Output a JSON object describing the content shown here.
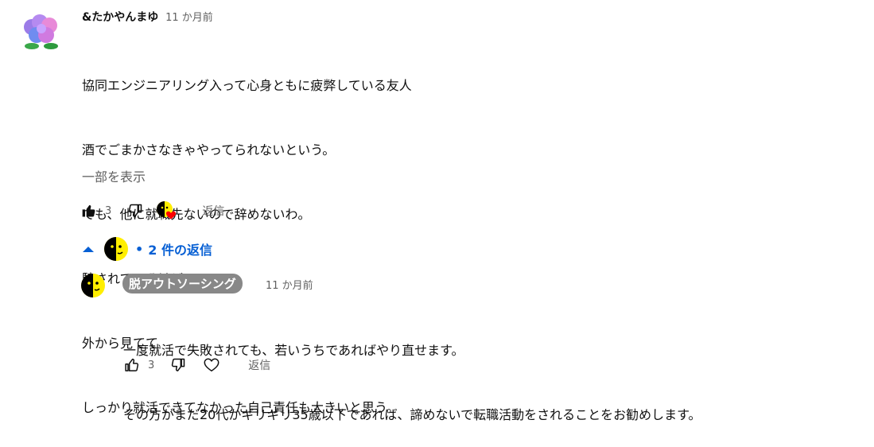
{
  "comment": {
    "author": "&たかやんまゆ",
    "time": "11 か月前",
    "lines": [
      "協同エンジニアリング入って心身ともに疲弊している友人",
      "酒でごまかさなきゃやってられないという。",
      "でも、他に就職先ないので辞めないわ。",
      "騙されているけど",
      "外から見てて",
      "しっかり就活できてなかった自己責任も大きいと思う。"
    ],
    "show_less": "一部を表示",
    "like_count": "3",
    "reply_label": "返信"
  },
  "replies_toggle": {
    "dot": "•",
    "label": "2 件の返信"
  },
  "reply": {
    "author": "脱アウトソーシング",
    "time": "11 か月前",
    "lines": [
      "一度就活で失敗されても、若いうちであればやり直せます。",
      "その方がまだ20代かギリギリ35歳以下であれば、諦めないで転職活動をされることをお勧めします。"
    ],
    "like_count": "3",
    "reply_label": "返信"
  },
  "colors": {
    "link_blue": "#065fd4",
    "muted": "#606060",
    "badge_bg": "#888888",
    "heart": "#ff0000",
    "avatar_yellow": "#ffee00"
  },
  "icons": [
    "hydrangea-avatar",
    "thumbs-up-icon",
    "thumbs-down-icon",
    "creator-heart-icon",
    "chevron-up-icon",
    "heart-outline-icon"
  ]
}
